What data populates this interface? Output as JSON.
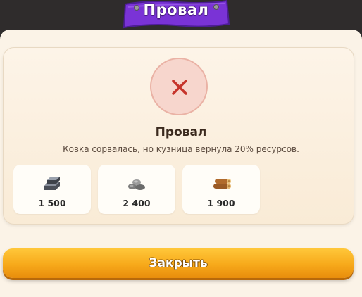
{
  "header": {
    "title": "Провал"
  },
  "result": {
    "status_icon": "close-x-icon",
    "title": "Провал",
    "message": "Ковка сорвалась, но кузница вернула 20% ресурсов."
  },
  "resources": [
    {
      "icon": "iron-ingot-icon",
      "amount": "1 500"
    },
    {
      "icon": "stone-icon",
      "amount": "2 400"
    },
    {
      "icon": "wood-logs-icon",
      "amount": "1 900"
    }
  ],
  "footer": {
    "close_label": "Закрыть"
  },
  "colors": {
    "header_plank": "#8a3fe0",
    "fail_accent": "#c6342b",
    "button": "#f7a91a"
  }
}
